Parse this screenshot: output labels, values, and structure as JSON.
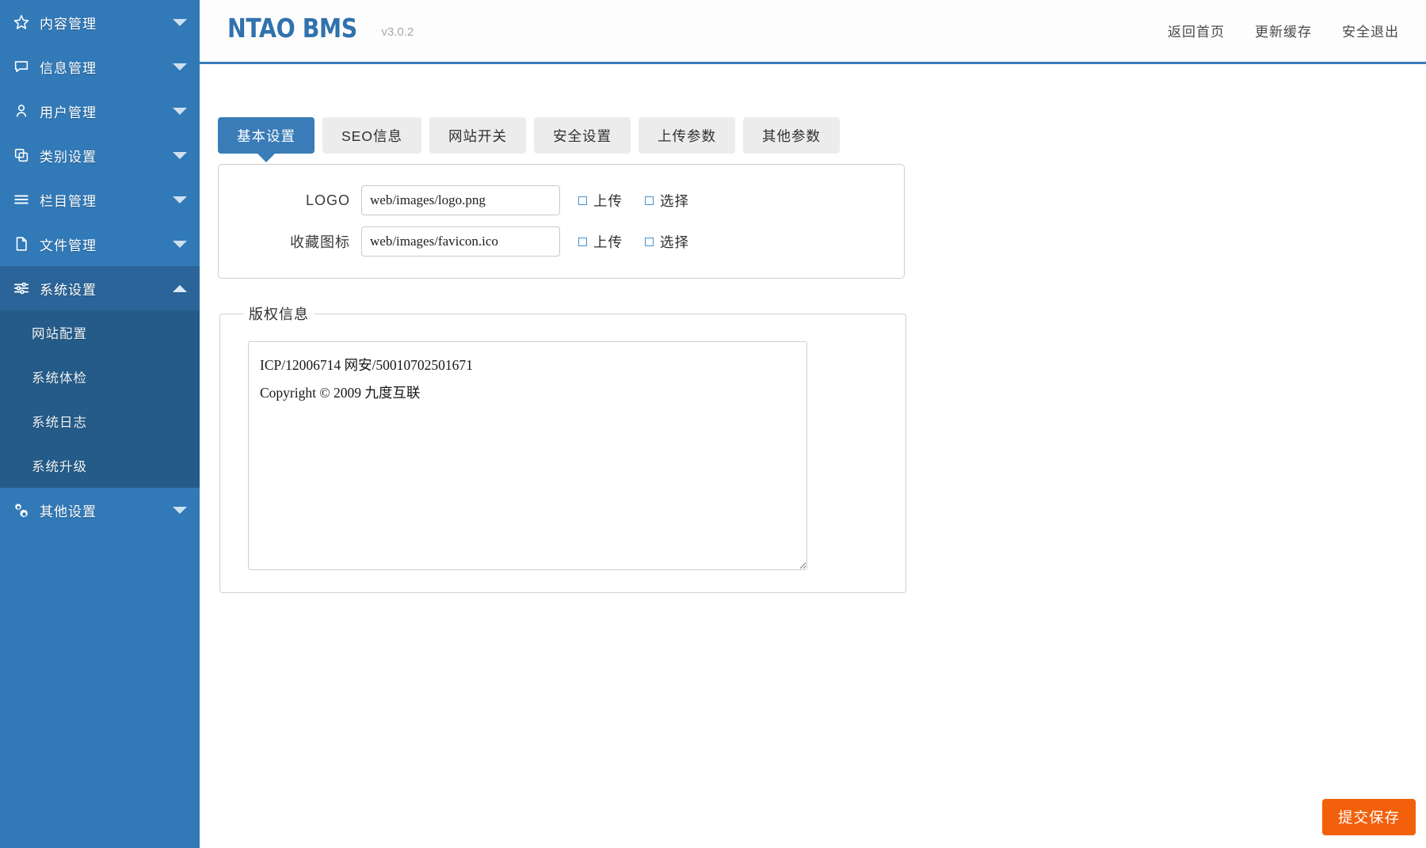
{
  "header": {
    "logo_text": "NTAO BMS",
    "version": "v3.0.2",
    "nav": [
      {
        "label": "返回首页",
        "name": "back-home"
      },
      {
        "label": "更新缓存",
        "name": "refresh-cache"
      },
      {
        "label": "安全退出",
        "name": "logout"
      }
    ]
  },
  "sidebar": {
    "items": [
      {
        "label": "内容管理",
        "icon": "star-icon",
        "caret": "down",
        "active": false
      },
      {
        "label": "信息管理",
        "icon": "chat-bubble-icon",
        "caret": "down",
        "active": false
      },
      {
        "label": "用户管理",
        "icon": "user-icon",
        "caret": "down",
        "active": false
      },
      {
        "label": "类别设置",
        "icon": "copy-icon",
        "caret": "down",
        "active": false
      },
      {
        "label": "栏目管理",
        "icon": "list-icon",
        "caret": "down",
        "active": false
      },
      {
        "label": "文件管理",
        "icon": "file-icon",
        "caret": "down",
        "active": false
      },
      {
        "label": "系统设置",
        "icon": "sliders-icon",
        "caret": "up",
        "active": true
      }
    ],
    "submenu": [
      {
        "label": "网站配置"
      },
      {
        "label": "系统体检"
      },
      {
        "label": "系统日志"
      },
      {
        "label": "系统升级"
      }
    ],
    "last_item": {
      "label": "其他设置",
      "icon": "gears-icon",
      "caret": "down",
      "active": false
    }
  },
  "main": {
    "tabs": [
      {
        "label": "基本设置",
        "active": true
      },
      {
        "label": "SEO信息",
        "active": false
      },
      {
        "label": "网站开关",
        "active": false
      },
      {
        "label": "安全设置",
        "active": false
      },
      {
        "label": "上传参数",
        "active": false
      },
      {
        "label": "其他参数",
        "active": false
      }
    ],
    "file_fields": [
      {
        "label": "LOGO",
        "value": "web/images/logo.png",
        "placeholder": "",
        "upload_label": "上传",
        "choose_label": "选择"
      },
      {
        "label": "收藏图标",
        "value": "web/images/favicon.ico",
        "placeholder": "",
        "upload_label": "上传",
        "choose_label": "选择"
      }
    ],
    "copyright": {
      "legend": "版权信息",
      "value": "ICP/12006714 网安/50010702501671\nCopyright © 2009 九度互联",
      "placeholder": ""
    },
    "submit_label": "提交保存"
  },
  "colors": {
    "sidebar_bg": "#3179b7",
    "sidebar_active_bg": "#2a6498",
    "submenu_bg": "#245b88",
    "accent": "#3a7cb8",
    "submit_bg": "#f2600c",
    "tab_inactive_bg": "#ececec"
  }
}
